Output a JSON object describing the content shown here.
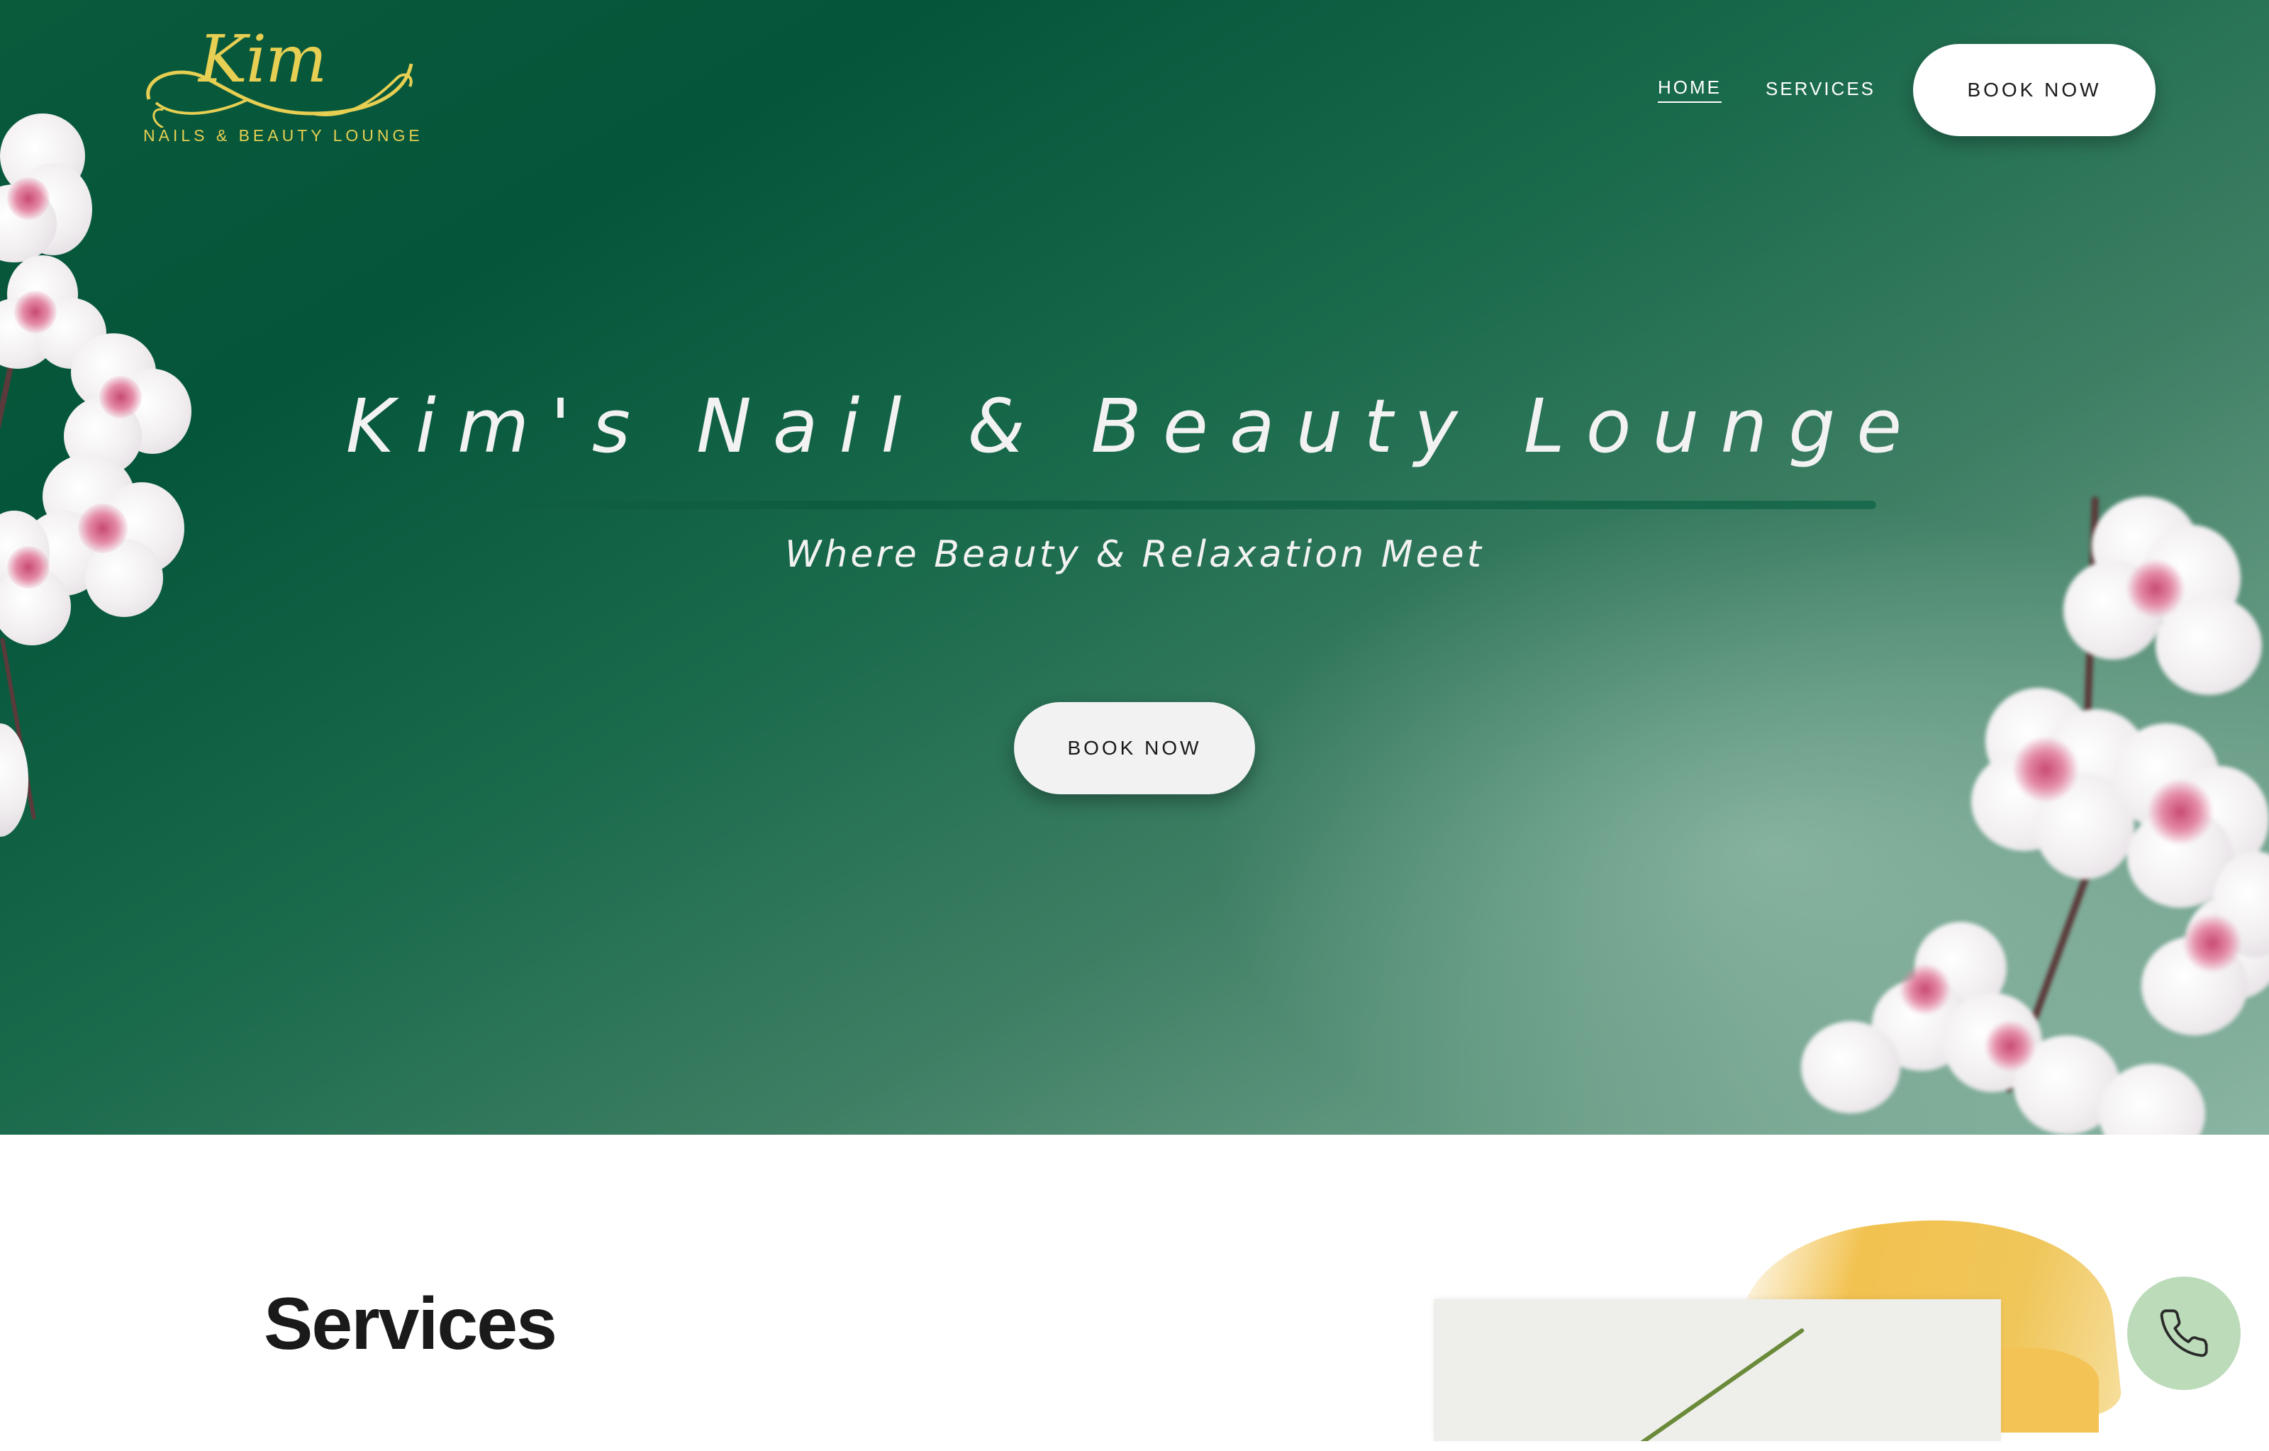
{
  "brand": {
    "logo_script": "Kim",
    "logo_subtitle": "NAILS & BEAUTY LOUNGE",
    "color": "#e6cf52"
  },
  "nav": {
    "items": [
      {
        "label": "HOME",
        "active": true
      },
      {
        "label": "SERVICES",
        "active": false
      }
    ],
    "cta_label": "BOOK NOW"
  },
  "hero": {
    "title": "Kim's Nail & Beauty Lounge",
    "subtitle": "Where Beauty & Relaxation Meet",
    "cta_label": "BOOK NOW",
    "bg_color_start": "#04553a",
    "bg_color_end": "#8ab5a3"
  },
  "services": {
    "title": "Services",
    "accent_color": "#f2c250"
  },
  "floating": {
    "icon": "phone-icon",
    "color": "#bcdbb9"
  }
}
